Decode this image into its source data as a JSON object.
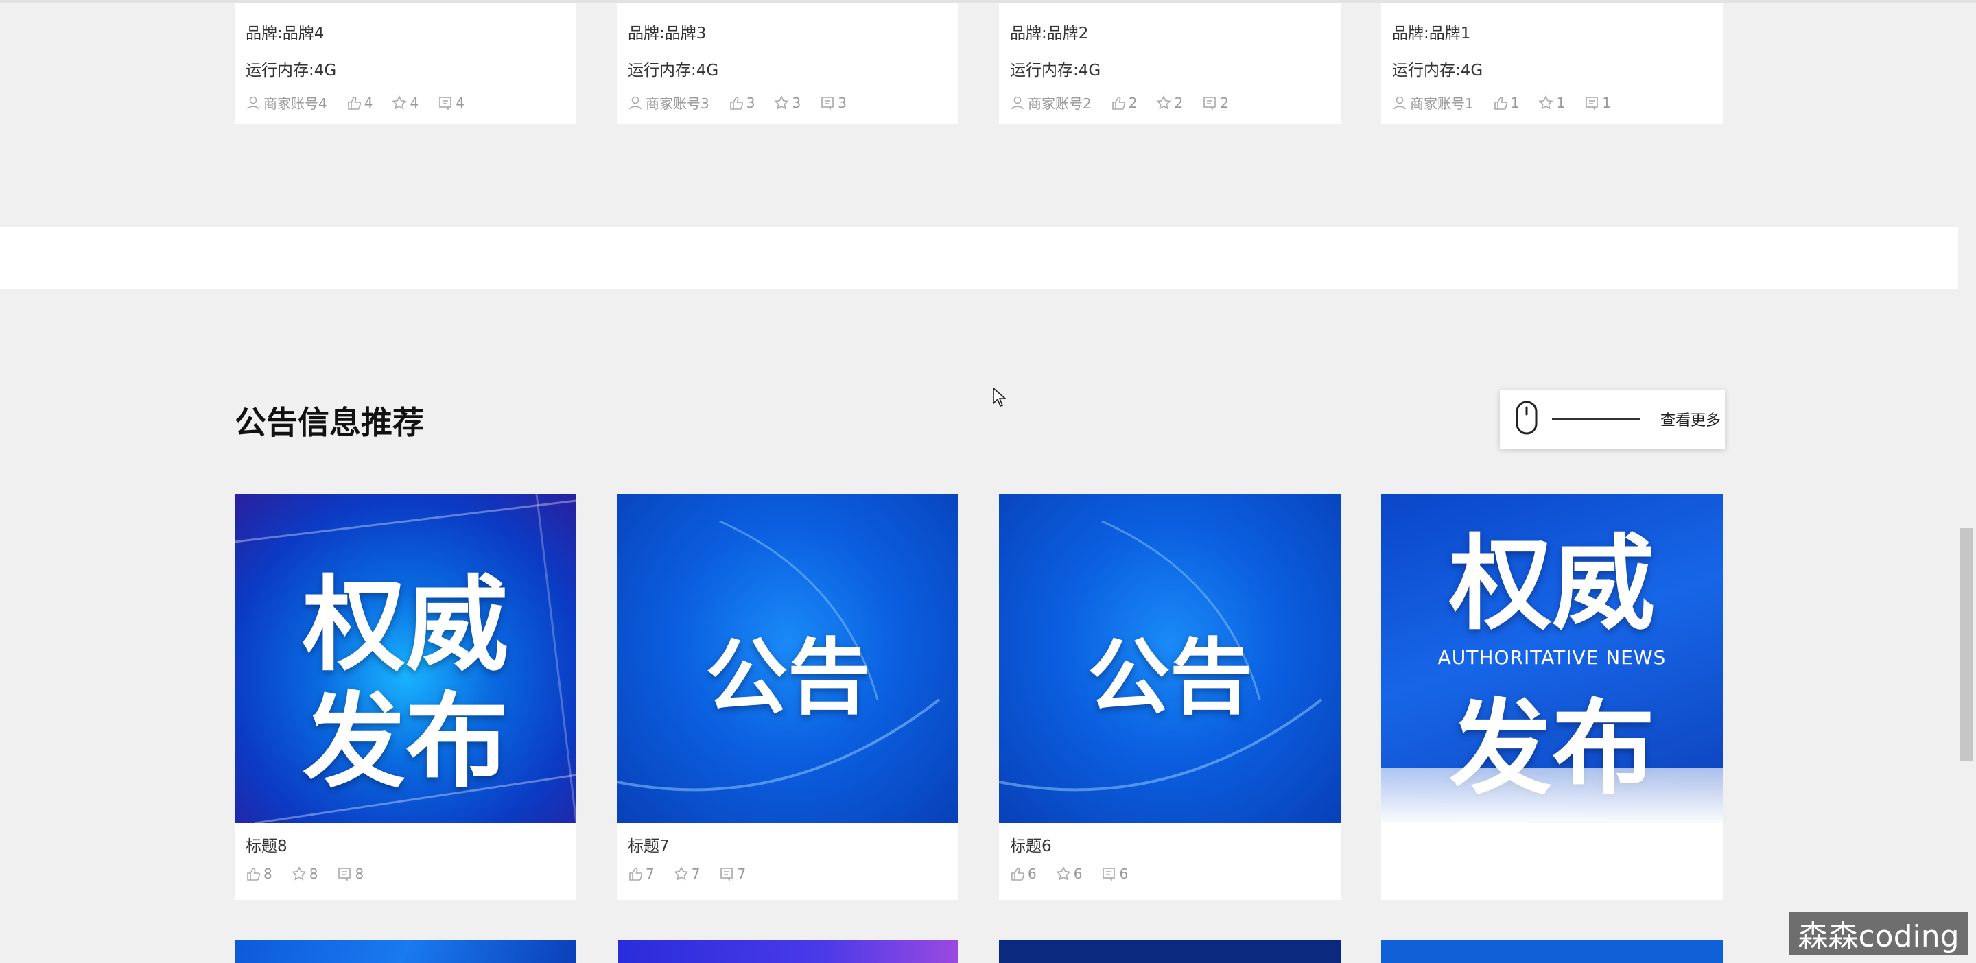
{
  "products": [
    {
      "brand": "品牌:品牌4",
      "memory": "运行内存:4G",
      "merchant": "商家账号4",
      "likes": "4",
      "favorites": "4",
      "comments": "4"
    },
    {
      "brand": "品牌:品牌3",
      "memory": "运行内存:4G",
      "merchant": "商家账号3",
      "likes": "3",
      "favorites": "3",
      "comments": "3"
    },
    {
      "brand": "品牌:品牌2",
      "memory": "运行内存:4G",
      "merchant": "商家账号2",
      "likes": "2",
      "favorites": "2",
      "comments": "2"
    },
    {
      "brand": "品牌:品牌1",
      "memory": "运行内存:4G",
      "merchant": "商家账号1",
      "likes": "1",
      "favorites": "1",
      "comments": "1"
    }
  ],
  "notice_section": {
    "title": "公告信息推荐",
    "more_label": "查看更多"
  },
  "notices": [
    {
      "title": "标题8",
      "image_line1": "权威",
      "image_line2": "发布",
      "likes": "8",
      "favorites": "8",
      "comments": "8"
    },
    {
      "title": "标题7",
      "image_text": "公告",
      "likes": "7",
      "favorites": "7",
      "comments": "7"
    },
    {
      "title": "标题6",
      "image_text": "公告",
      "likes": "6",
      "favorites": "6",
      "comments": "6"
    },
    {
      "title": "",
      "image_line1": "权威",
      "image_sub": "AUTHORITATIVE NEWS",
      "image_line2": "发布",
      "likes": "",
      "favorites": "",
      "comments": ""
    }
  ],
  "watermark": "森森coding",
  "icons": {
    "user": "user-icon",
    "like": "thumbs-up-icon",
    "favorite": "star-icon",
    "comment": "comment-icon",
    "mouse": "mouse-icon"
  },
  "colors": {
    "accent": "#0b5fe0",
    "background": "#f0f0f0"
  }
}
